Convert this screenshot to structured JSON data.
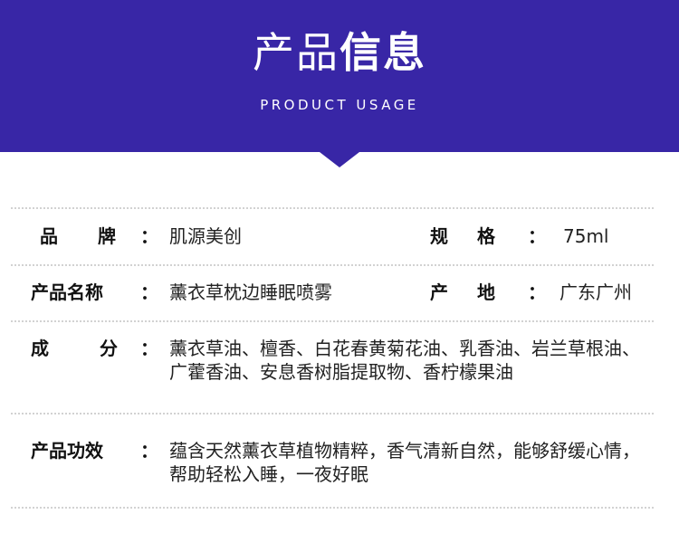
{
  "header": {
    "title_light": "产品",
    "title_bold": "信息",
    "subtitle": "PRODUCT USAGE",
    "bg_color": "#3826a6"
  },
  "info": {
    "colon": "：",
    "brand_label": "品　牌",
    "brand_value": "肌源美创",
    "spec_label": "规　格",
    "spec_value": "75ml",
    "name_label": "产品名称",
    "name_value": "薰衣草枕边睡眠喷雾",
    "origin_label": "产　地",
    "origin_value": "广东广州",
    "ingredients_label": "成　分",
    "ingredients_value": "薰衣草油、檀香、白花春黄菊花油、乳香油、岩兰草根油、广藿香油、安息香树脂提取物、香柠檬果油",
    "effect_label": "产品功效",
    "effect_value": "蕴含天然薰衣草植物精粹，香气清新自然，能够舒缓心情，帮助轻松入睡，一夜好眠"
  }
}
